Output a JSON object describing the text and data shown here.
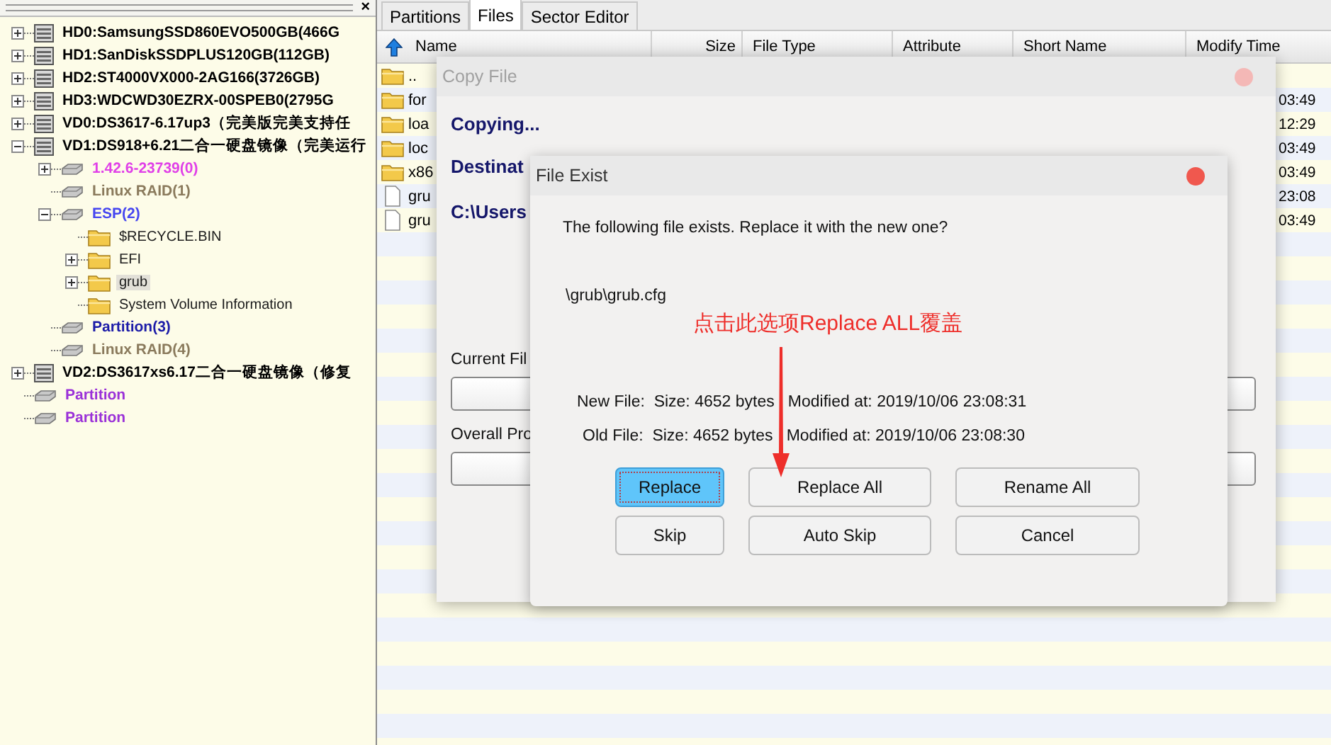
{
  "tree_panel": {
    "close_label": "×",
    "items": [
      {
        "label": "HD0:SamsungSSD860EVO500GB(466G",
        "kind": "disk",
        "color": "#000000",
        "expanded": false,
        "selected": false
      },
      {
        "label": "HD1:SanDiskSSDPLUS120GB(112GB)",
        "kind": "disk",
        "color": "#000000",
        "expanded": false,
        "selected": false
      },
      {
        "label": "HD2:ST4000VX000-2AG166(3726GB)",
        "kind": "disk",
        "color": "#000000",
        "expanded": false,
        "selected": false
      },
      {
        "label": "HD3:WDCWD30EZRX-00SPEB0(2795G",
        "kind": "disk",
        "color": "#000000",
        "expanded": false,
        "selected": false
      },
      {
        "label": "VD0:DS3617-6.17up3（完美版完美支持任",
        "kind": "disk",
        "color": "#000000",
        "expanded": false,
        "selected": false
      },
      {
        "label": "VD1:DS918+6.21二合一硬盘镜像（完美运行",
        "kind": "disk",
        "color": "#000000",
        "expanded": true,
        "selected": false,
        "children": [
          {
            "label": "1.42.6-23739(0)",
            "kind": "partition",
            "color": "#e040e8",
            "expanded": false,
            "selected": false
          },
          {
            "label": "Linux RAID(1)",
            "kind": "partition",
            "color": "#8a7a5c",
            "selected": false
          },
          {
            "label": "ESP(2)",
            "kind": "partition",
            "color": "#4646f0",
            "expanded": true,
            "selected": false,
            "children": [
              {
                "label": "$RECYCLE.BIN",
                "kind": "folder",
                "color": "#1a1a1a",
                "selected": false
              },
              {
                "label": "EFI",
                "kind": "folder",
                "color": "#1a1a1a",
                "expanded": false,
                "selected": false
              },
              {
                "label": "grub",
                "kind": "folder",
                "color": "#1a1a1a",
                "expanded": false,
                "selected": true
              },
              {
                "label": "System Volume Information",
                "kind": "folder",
                "color": "#1a1a1a",
                "selected": false
              }
            ]
          },
          {
            "label": "Partition(3)",
            "kind": "partition",
            "color": "#1c1ca8",
            "selected": false
          },
          {
            "label": "Linux RAID(4)",
            "kind": "partition",
            "color": "#8a7a5c",
            "selected": false
          }
        ]
      },
      {
        "label": "VD2:DS3617xs6.17二合一硬盘镜像（修复",
        "kind": "disk",
        "color": "#000000",
        "expanded": false,
        "selected": false
      },
      {
        "label": "Partition",
        "kind": "partition",
        "color": "#9a30d8",
        "selected": false
      },
      {
        "label": "Partition",
        "kind": "partition",
        "color": "#9a30d8",
        "selected": false
      }
    ]
  },
  "tabs": [
    {
      "label": "Partitions",
      "selected": false
    },
    {
      "label": "Files",
      "selected": true
    },
    {
      "label": "Sector Editor",
      "selected": false
    }
  ],
  "file_table": {
    "columns": [
      "Name",
      "Size",
      "File Type",
      "Attribute",
      "Short Name",
      "Modify Time"
    ],
    "rows": [
      {
        "kind": "folder",
        "name": ".."
      },
      {
        "kind": "folder",
        "name": "for",
        "modify_time": "03:49"
      },
      {
        "kind": "folder",
        "name": "loa",
        "modify_time": "12:29"
      },
      {
        "kind": "folder",
        "name": "loc",
        "modify_time": "03:49"
      },
      {
        "kind": "folder",
        "name": "x86",
        "modify_time": "03:49"
      },
      {
        "kind": "file",
        "name": "gru",
        "modify_time": "23:08"
      },
      {
        "kind": "file",
        "name": "gru",
        "modify_time": "03:49"
      }
    ]
  },
  "copy_dialog": {
    "title": "Copy File",
    "status": "Copying...",
    "destination_label": "Destinat",
    "destination_path": "C:\\Users",
    "current_file_label": "Current Fil",
    "current_file_progress": {
      "level": 0
    },
    "overall_label": "Overall Pro",
    "overall_progress": {
      "level": 0
    }
  },
  "exist_dialog": {
    "title": "File Exist",
    "message": "The following file exists. Replace it with the new one?",
    "file_path": "\\grub\\grub.cfg",
    "new_file": "New File:  Size: 4652 bytes   Modified at: 2019/10/06 23:08:31",
    "old_file": "Old File:  Size: 4652 bytes   Modified at: 2019/10/06 23:08:30",
    "buttons": [
      {
        "label": "Replace",
        "default": true
      },
      {
        "label": "Replace All",
        "default": false
      },
      {
        "label": "Rename All",
        "default": false
      },
      {
        "label": "Skip",
        "default": false
      },
      {
        "label": "Auto Skip",
        "default": false
      },
      {
        "label": "Cancel",
        "default": false
      }
    ]
  },
  "annotation": {
    "text": "点击此选项Replace ALL覆盖"
  }
}
